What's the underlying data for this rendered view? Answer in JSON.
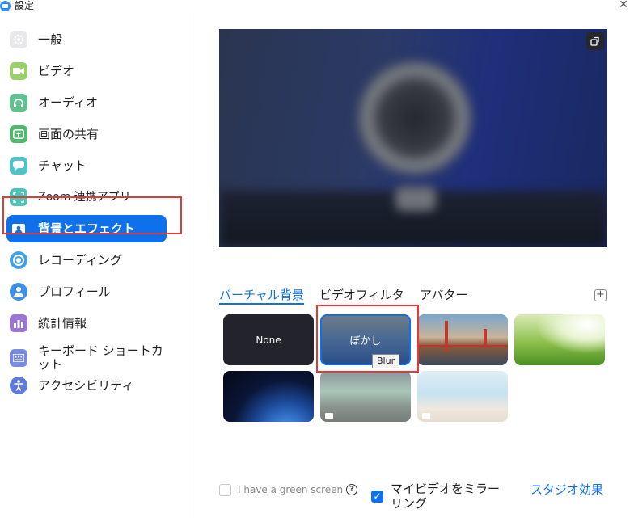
{
  "window": {
    "title": "設定"
  },
  "sidebar": {
    "items": [
      {
        "label": "一般",
        "icon": "gear-icon",
        "color": "#E8E8EB"
      },
      {
        "label": "ビデオ",
        "icon": "video-camera-icon",
        "color": "#9AD06B"
      },
      {
        "label": "オーディオ",
        "icon": "headphones-icon",
        "color": "#5FC28F"
      },
      {
        "label": "画面の共有",
        "icon": "share-screen-icon",
        "color": "#52B86E"
      },
      {
        "label": "チャット",
        "icon": "chat-bubble-icon",
        "color": "#4FC3C8"
      },
      {
        "label": "Zoom 連携アプリ",
        "icon": "apps-icon",
        "color": "#4CC3B5"
      },
      {
        "label": "背景とエフェクト",
        "icon": "portrait-background-icon",
        "color": "#0E71EB",
        "active": true
      },
      {
        "label": "レコーディング",
        "icon": "record-icon",
        "color": "#3EA2E8"
      },
      {
        "label": "プロフィール",
        "icon": "profile-icon",
        "color": "#3E8FE8"
      },
      {
        "label": "統計情報",
        "icon": "statistics-icon",
        "color": "#9B74D6"
      },
      {
        "label": "キーボード ショートカット",
        "icon": "keyboard-icon",
        "color": "#7A8BDD"
      },
      {
        "label": "アクセシビリティ",
        "icon": "accessibility-icon",
        "color": "#5D7ADC"
      }
    ]
  },
  "main": {
    "tabs": [
      {
        "label": "バーチャル背景",
        "active": true
      },
      {
        "label": "ビデオフィルタ",
        "active": false
      },
      {
        "label": "アバター",
        "active": false
      }
    ],
    "backgrounds": [
      {
        "name": "None",
        "label": "None"
      },
      {
        "name": "blur",
        "label": "ぼかし",
        "selected": true,
        "tooltip": "Blur"
      },
      {
        "name": "golden-gate-bridge"
      },
      {
        "name": "grass"
      },
      {
        "name": "earth-from-space"
      },
      {
        "name": "aurora",
        "video": true
      },
      {
        "name": "beach",
        "video": true
      }
    ],
    "green_screen_label": "I have a green screen",
    "green_screen_checked": false,
    "mirror_label": "マイビデオをミラーリング",
    "mirror_checked": true,
    "studio_effects_label": "スタジオ効果"
  },
  "colors": {
    "accent": "#0E71EB",
    "highlight_frame": "#E53935"
  }
}
